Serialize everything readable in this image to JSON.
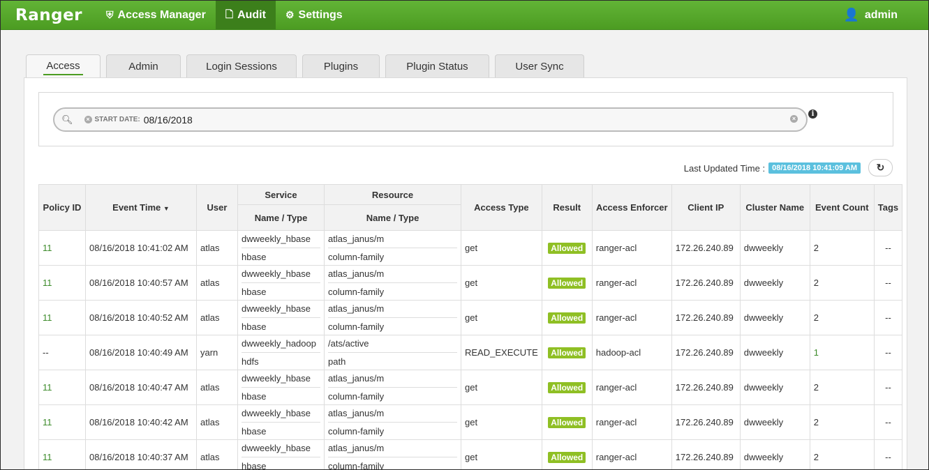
{
  "navbar": {
    "brand": "Ranger",
    "items": [
      {
        "label": "Access Manager",
        "icon": "shield-icon",
        "active": false
      },
      {
        "label": "Audit",
        "icon": "file-icon",
        "active": true
      },
      {
        "label": "Settings",
        "icon": "gear-icon",
        "active": false
      }
    ],
    "user": "admin"
  },
  "tabs": [
    "Access",
    "Admin",
    "Login Sessions",
    "Plugins",
    "Plugin Status",
    "User Sync"
  ],
  "search": {
    "chip_label": "START DATE:",
    "chip_value": "08/16/2018"
  },
  "last_updated": {
    "label": "Last Updated Time :",
    "value": "08/16/2018 10:41:09 AM"
  },
  "table": {
    "group_headers": {
      "service": "Service",
      "resource": "Resource"
    },
    "headers": {
      "policy_id": "Policy ID",
      "event_time": "Event Time",
      "user": "User",
      "service": "Name / Type",
      "resource": "Name / Type",
      "access_type": "Access Type",
      "result": "Result",
      "enforcer": "Access Enforcer",
      "client_ip": "Client IP",
      "cluster": "Cluster Name",
      "count": "Event Count",
      "tags": "Tags"
    },
    "rows": [
      {
        "policy_id": "11",
        "event_time": "08/16/2018 10:41:02 AM",
        "user": "atlas",
        "service_name": "dwweekly_hbase",
        "service_type": "hbase",
        "resource_name": "atlas_janus/m",
        "resource_type": "column-family",
        "access_type": "get",
        "result": "Allowed",
        "enforcer": "ranger-acl",
        "client_ip": "172.26.240.89",
        "cluster": "dwweekly",
        "count": "2",
        "tags": "--"
      },
      {
        "policy_id": "11",
        "event_time": "08/16/2018 10:40:57 AM",
        "user": "atlas",
        "service_name": "dwweekly_hbase",
        "service_type": "hbase",
        "resource_name": "atlas_janus/m",
        "resource_type": "column-family",
        "access_type": "get",
        "result": "Allowed",
        "enforcer": "ranger-acl",
        "client_ip": "172.26.240.89",
        "cluster": "dwweekly",
        "count": "2",
        "tags": "--"
      },
      {
        "policy_id": "11",
        "event_time": "08/16/2018 10:40:52 AM",
        "user": "atlas",
        "service_name": "dwweekly_hbase",
        "service_type": "hbase",
        "resource_name": "atlas_janus/m",
        "resource_type": "column-family",
        "access_type": "get",
        "result": "Allowed",
        "enforcer": "ranger-acl",
        "client_ip": "172.26.240.89",
        "cluster": "dwweekly",
        "count": "2",
        "tags": "--"
      },
      {
        "policy_id": "--",
        "event_time": "08/16/2018 10:40:49 AM",
        "user": "yarn",
        "service_name": "dwweekly_hadoop",
        "service_type": "hdfs",
        "resource_name": "/ats/active",
        "resource_type": "path",
        "access_type": "READ_EXECUTE",
        "result": "Allowed",
        "enforcer": "hadoop-acl",
        "client_ip": "172.26.240.89",
        "cluster": "dwweekly",
        "count": "1",
        "tags": "--"
      },
      {
        "policy_id": "11",
        "event_time": "08/16/2018 10:40:47 AM",
        "user": "atlas",
        "service_name": "dwweekly_hbase",
        "service_type": "hbase",
        "resource_name": "atlas_janus/m",
        "resource_type": "column-family",
        "access_type": "get",
        "result": "Allowed",
        "enforcer": "ranger-acl",
        "client_ip": "172.26.240.89",
        "cluster": "dwweekly",
        "count": "2",
        "tags": "--"
      },
      {
        "policy_id": "11",
        "event_time": "08/16/2018 10:40:42 AM",
        "user": "atlas",
        "service_name": "dwweekly_hbase",
        "service_type": "hbase",
        "resource_name": "atlas_janus/m",
        "resource_type": "column-family",
        "access_type": "get",
        "result": "Allowed",
        "enforcer": "ranger-acl",
        "client_ip": "172.26.240.89",
        "cluster": "dwweekly",
        "count": "2",
        "tags": "--"
      },
      {
        "policy_id": "11",
        "event_time": "08/16/2018 10:40:37 AM",
        "user": "atlas",
        "service_name": "dwweekly_hbase",
        "service_type": "hbase",
        "resource_name": "atlas_janus/m",
        "resource_type": "column-family",
        "access_type": "get",
        "result": "Allowed",
        "enforcer": "ranger-acl",
        "client_ip": "172.26.240.89",
        "cluster": "dwweekly",
        "count": "2",
        "tags": "--"
      }
    ]
  },
  "colors": {
    "brand_green": "#4c9c22",
    "allowed_badge": "#8fbf24",
    "updated_badge": "#5bc0de"
  }
}
